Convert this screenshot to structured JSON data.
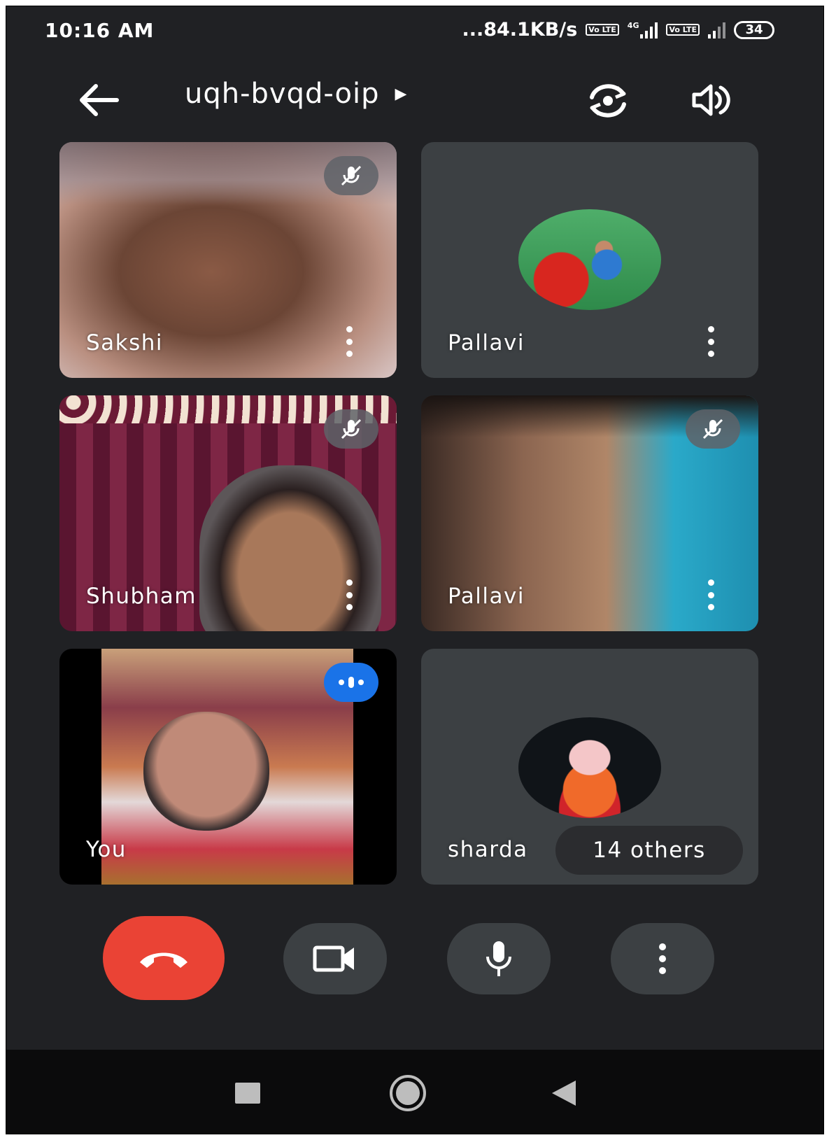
{
  "status_bar": {
    "time": "10:16 AM",
    "network_speed": "...84.1KB/s",
    "volte_label": "Vo LTE",
    "network_type": "4G",
    "battery": "34"
  },
  "header": {
    "meeting_code": "uqh-bvqd-oip"
  },
  "participants": [
    {
      "name": "Sakshi",
      "muted": true
    },
    {
      "name": "Pallavi",
      "muted": false,
      "has_avatar": true
    },
    {
      "name": "Shubham",
      "muted": true
    },
    {
      "name": "Pallavi",
      "muted": true
    },
    {
      "name": "You",
      "speaking": true
    },
    {
      "name": "sharda",
      "has_avatar": true,
      "others_label": "14 others"
    }
  ],
  "colors": {
    "background": "#202124",
    "tile": "#3c4043",
    "end_call": "#ea4335",
    "speaking_indicator": "#1a73e8"
  }
}
